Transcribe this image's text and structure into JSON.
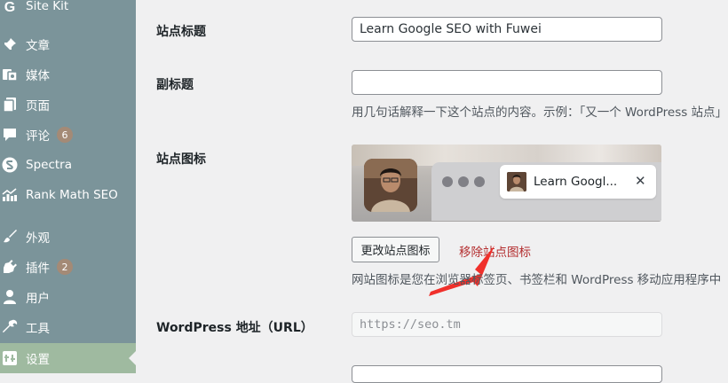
{
  "sidebar": {
    "items": [
      {
        "label": "Site Kit",
        "icon": "site-kit-g-icon"
      },
      {
        "label": "文章",
        "icon": "pushpin-icon"
      },
      {
        "label": "媒体",
        "icon": "media-icon"
      },
      {
        "label": "页面",
        "icon": "page-icon"
      },
      {
        "label": "评论",
        "icon": "comment-icon",
        "badge": "6"
      },
      {
        "label": "Spectra",
        "icon": "spectra-icon"
      },
      {
        "label": "Rank Math SEO",
        "icon": "rank-math-icon"
      },
      {
        "label": "外观",
        "icon": "paintbrush-icon"
      },
      {
        "label": "插件",
        "icon": "plugin-icon",
        "badge": "2"
      },
      {
        "label": "用户",
        "icon": "user-icon"
      },
      {
        "label": "工具",
        "icon": "wrench-icon"
      },
      {
        "label": "设置",
        "icon": "settings-icon",
        "active": true
      }
    ]
  },
  "form": {
    "site_title": {
      "label": "站点标题",
      "value": "Learn Google SEO with Fuwei"
    },
    "tagline": {
      "label": "副标题",
      "value": "",
      "description": "用几句话解释一下这个站点的内容。示例：「又一个 WordPress 站点」"
    },
    "site_icon": {
      "label": "站点图标",
      "preview_tab_title": "Learn Googl...",
      "tab_close": "✕",
      "change_button": "更改站点图标",
      "remove_link": "移除站点图标",
      "description": "网站图标是您在浏览器标签页、书签栏和 WordPress 移动应用程序中"
    },
    "wordpress_url": {
      "label": "WordPress 地址（URL）",
      "value": "https://seo.tm"
    }
  },
  "colors": {
    "sidebar_bg": "#7b949a",
    "sidebar_active": "#9fbaa0",
    "badge": "#a48a76",
    "remove_link": "#b32d2e",
    "annotation_arrow": "#f0302b"
  }
}
